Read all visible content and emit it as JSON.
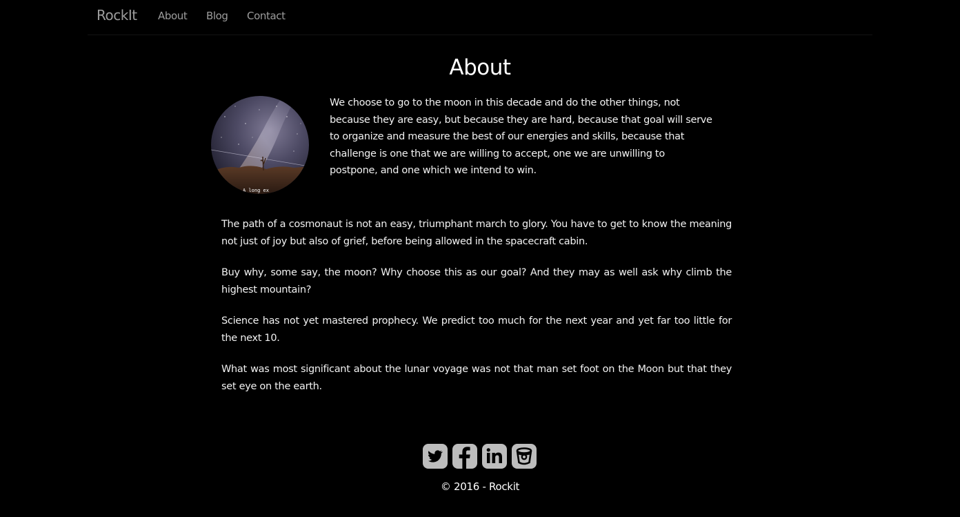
{
  "navbar": {
    "brand": "RockIt",
    "links": [
      {
        "label": "About"
      },
      {
        "label": "Blog"
      },
      {
        "label": "Contact"
      }
    ]
  },
  "main": {
    "title": "About",
    "avatar": {
      "icon": "milky-way-photo",
      "caption": "A long ex"
    },
    "intro": "We choose to go to the moon in this decade and do the other things, not because they are easy, but because they are hard, because that goal will serve to organize and measure the best of our energies and skills, because that challenge is one that we are willing to accept, one we are unwilling to postpone, and one which we intend to win.",
    "paragraphs": [
      "The path of a cosmonaut is not an easy, triumphant march to glory. You have to get to know the meaning not just of joy but also of grief, before being allowed in the spacecraft cabin.",
      "Buy why, some say, the moon? Why choose this as our goal? And they may as well ask why climb the highest mountain?",
      "Science has not yet mastered prophecy. We predict too much for the next year and yet far too little for the next 10.",
      "What was most significant about the lunar voyage was not that man set foot on the Moon but that they set eye on the earth."
    ]
  },
  "footer": {
    "social": [
      {
        "icon": "twitter-icon"
      },
      {
        "icon": "facebook-icon"
      },
      {
        "icon": "linkedin-icon"
      },
      {
        "icon": "bucket-icon"
      }
    ],
    "copyright": "© 2016 - Rockit"
  },
  "colors": {
    "background": "#000000",
    "text": "#f2f2f2",
    "nav_text": "#9d9d9d",
    "social_bg": "#bdbdbd"
  }
}
